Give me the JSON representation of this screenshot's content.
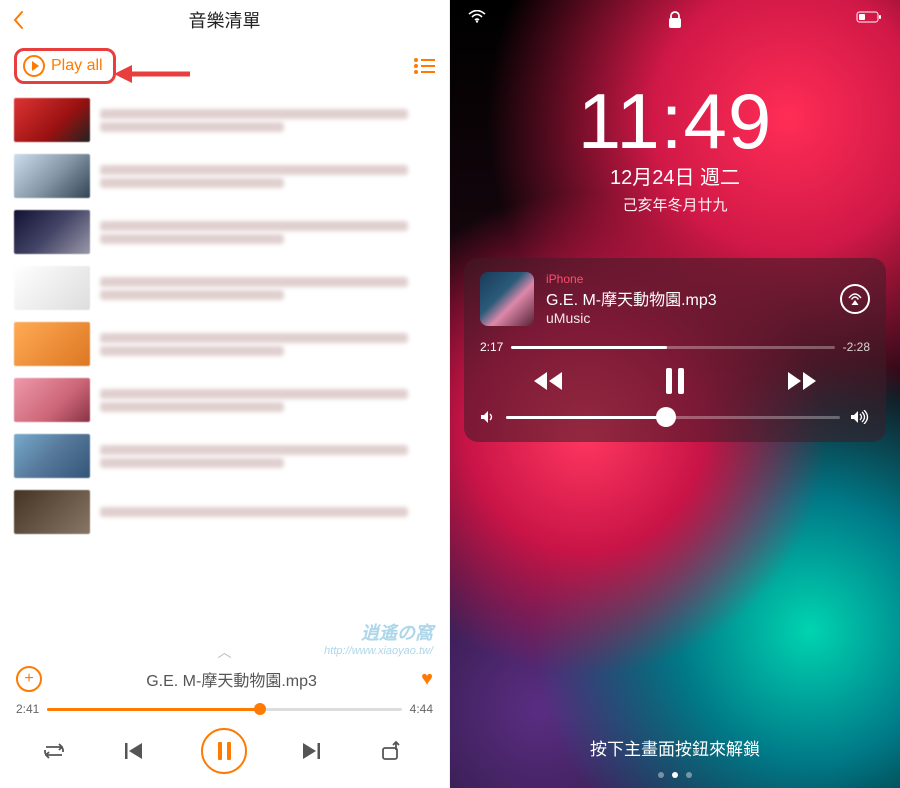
{
  "left": {
    "header": {
      "title": "音樂清單"
    },
    "playall_label": "Play all",
    "watermark": {
      "brand": "逍遙の窩",
      "url": "http://www.xiaoyao.tw/"
    },
    "mini": {
      "title": "G.E. M-摩天動物園.mp3",
      "elapsed": "2:41",
      "total": "4:44",
      "progress_pct": 60
    }
  },
  "right": {
    "clock": {
      "time": "11:49",
      "date": "12月24日 週二",
      "lunar": "己亥年冬月廿九"
    },
    "media": {
      "source": "iPhone",
      "track": "G.E. M-摩天動物園.mp3",
      "app": "uMusic",
      "elapsed": "2:17",
      "remaining": "-2:28",
      "progress_pct": 48,
      "volume_pct": 48
    },
    "unlock_hint": "按下主畫面按鈕來解鎖"
  }
}
